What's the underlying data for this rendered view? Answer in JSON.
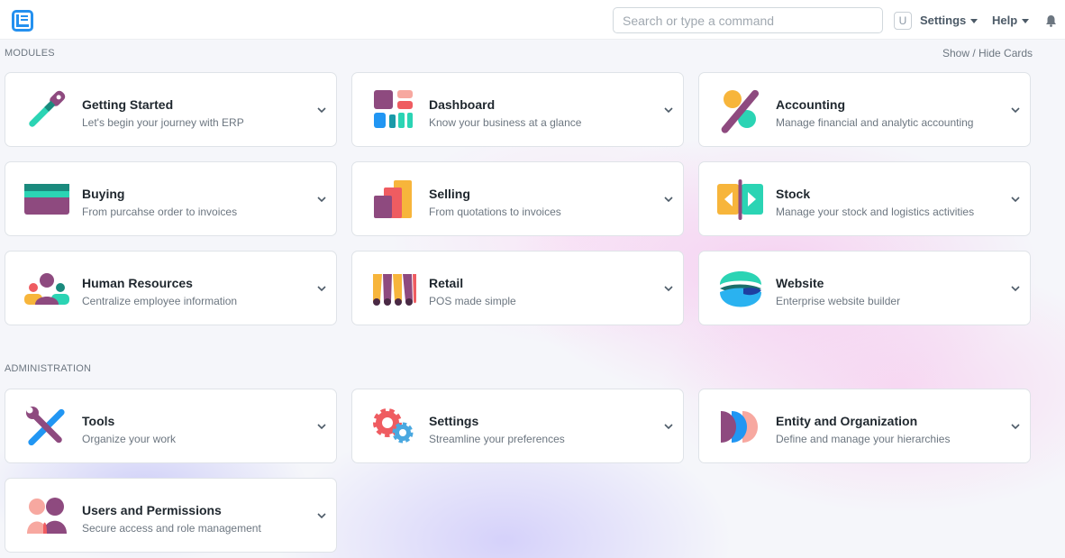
{
  "navbar": {
    "search_placeholder": "Search or type a command",
    "avatar_letter": "U",
    "settings_label": "Settings",
    "help_label": "Help"
  },
  "modules": {
    "heading": "MODULES",
    "show_hide_label": "Show / Hide Cards",
    "cards": [
      {
        "title": "Getting Started",
        "desc": "Let's begin your journey with ERP",
        "icon": "key-icon"
      },
      {
        "title": "Dashboard",
        "desc": "Know your business at a glance",
        "icon": "dashboard-icon"
      },
      {
        "title": "Accounting",
        "desc": "Manage financial and analytic accounting",
        "icon": "percent-icon"
      },
      {
        "title": "Buying",
        "desc": "From purcahse order to invoices",
        "icon": "credit-card-icon"
      },
      {
        "title": "Selling",
        "desc": "From quotations to invoices",
        "icon": "bar-chart-icon"
      },
      {
        "title": "Stock",
        "desc": "Manage your stock and logistics activities",
        "icon": "stock-arrows-icon"
      },
      {
        "title": "Human Resources",
        "desc": "Centralize employee information",
        "icon": "people-icon"
      },
      {
        "title": "Retail",
        "desc": "POS made simple",
        "icon": "shop-awning-icon"
      },
      {
        "title": "Website",
        "desc": "Enterprise website builder",
        "icon": "globe-waves-icon"
      }
    ]
  },
  "administration": {
    "heading": "ADMINISTRATION",
    "cards": [
      {
        "title": "Tools",
        "desc": "Organize your work",
        "icon": "tools-icon"
      },
      {
        "title": "Settings",
        "desc": "Streamline your preferences",
        "icon": "gears-icon"
      },
      {
        "title": "Entity and Organization",
        "desc": "Define and manage your hierarchies",
        "icon": "entity-icon"
      },
      {
        "title": "Users and Permissions",
        "desc": "Secure access and role management",
        "icon": "users-icon"
      }
    ]
  },
  "colors": {
    "brand": "#2490ef",
    "purple": "#8e4a7f",
    "teal": "#2bd4b4",
    "orange": "#f7b53b",
    "coral": "#ef5c61",
    "blue": "#2196f3"
  }
}
